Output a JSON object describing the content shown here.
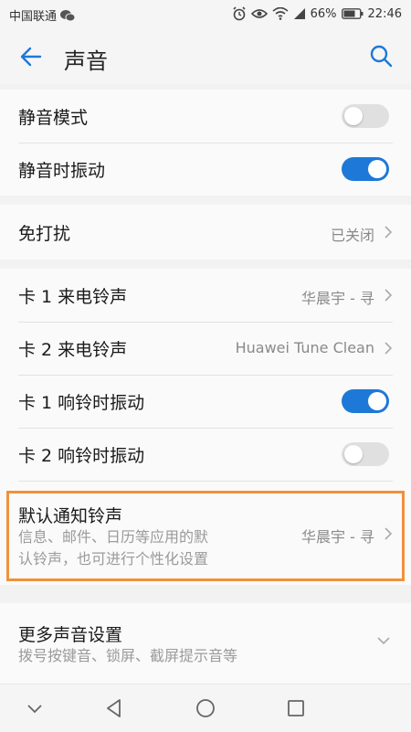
{
  "status": {
    "carrier": "中国联通",
    "battery": "66%",
    "time": "22:46"
  },
  "header": {
    "title": "声音"
  },
  "rows": {
    "silent_mode": {
      "label": "静音模式",
      "toggle": "off"
    },
    "vibrate_when_silent": {
      "label": "静音时振动",
      "toggle": "on"
    },
    "do_not_disturb": {
      "label": "免打扰",
      "value": "已关闭"
    },
    "sim1_ringtone": {
      "label": "卡 1 来电铃声",
      "value": "华晨宇 - 寻"
    },
    "sim2_ringtone": {
      "label": "卡 2 来电铃声",
      "value": "Huawei Tune Clean"
    },
    "sim1_vibrate": {
      "label": "卡 1 响铃时振动",
      "toggle": "on"
    },
    "sim2_vibrate": {
      "label": "卡 2 响铃时振动",
      "toggle": "off"
    },
    "default_notification": {
      "label": "默认通知铃声",
      "subtitle_line1": "信息、邮件、日历等应用的默",
      "subtitle_line2": "认铃声，也可进行个性化设置",
      "value": "华晨宇 - 寻"
    },
    "more_sound_settings": {
      "label": "更多声音设置",
      "subtitle": "拨号按键音、锁屏、截屏提示音等"
    }
  },
  "colors": {
    "accent": "#1e78d8",
    "highlight": "#f0913b"
  },
  "icons": [
    "wechat-icon",
    "alarm-icon",
    "eye-icon",
    "wifi-icon",
    "signal-icon",
    "battery-icon",
    "back-arrow-icon",
    "search-icon",
    "chevron-right-icon",
    "chevron-down-icon",
    "nav-back-icon",
    "nav-home-icon",
    "nav-recents-icon",
    "nav-hide-icon"
  ]
}
